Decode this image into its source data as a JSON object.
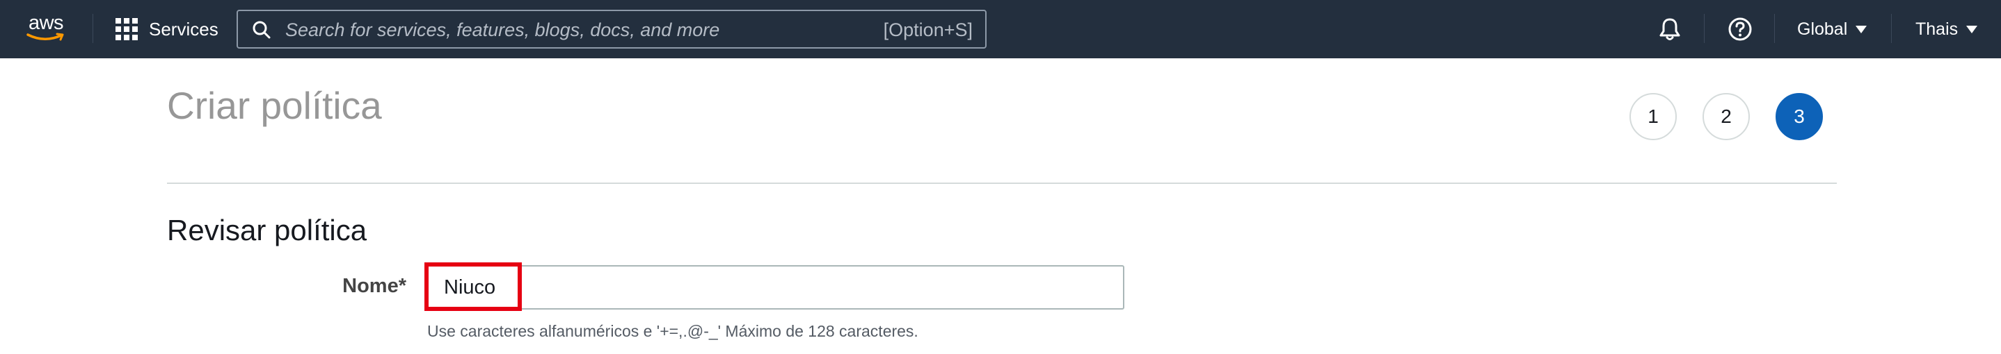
{
  "topnav": {
    "logo_text": "aws",
    "services_label": "Services",
    "search_placeholder": "Search for services, features, blogs, docs, and more",
    "search_shortcut": "[Option+S]",
    "region_label": "Global",
    "user_label": "Thais",
    "icons": [
      "grid-icon",
      "search-icon",
      "bell-icon",
      "help-icon",
      "caret-down-icon"
    ]
  },
  "page": {
    "title": "Criar política",
    "steps": [
      "1",
      "2",
      "3"
    ],
    "active_step": "3",
    "section_title": "Revisar política"
  },
  "form": {
    "name_label": "Nome*",
    "name_value": "Niuco",
    "name_hint": "Use caracteres alfanuméricos e '+=,.@-_' Máximo de 128 caracteres."
  },
  "colors": {
    "navbar": "#232f3e",
    "accent": "#0d62b8",
    "highlight": "#e60012"
  }
}
